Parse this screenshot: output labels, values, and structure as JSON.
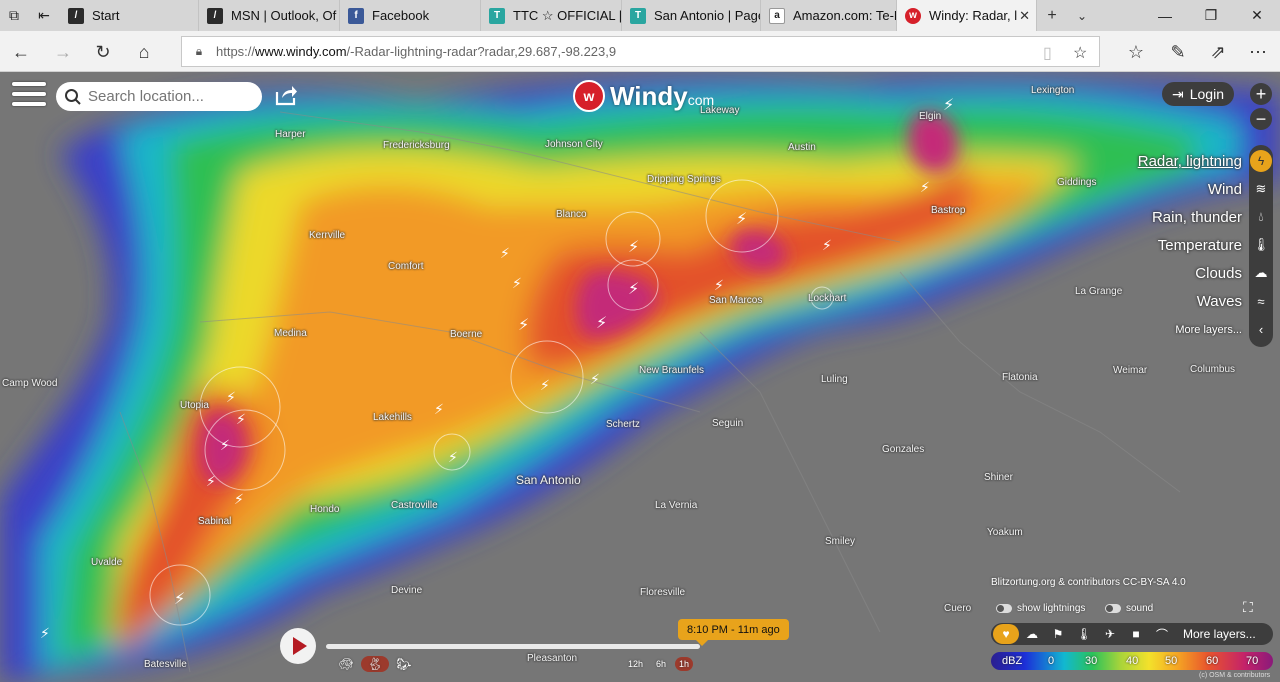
{
  "browser": {
    "tabs": [
      {
        "label": "Start",
        "favicon": "edge-page-icon",
        "color": "#2b2b2b"
      },
      {
        "label": "MSN | Outlook, Of",
        "favicon": "edge-page-icon",
        "color": "#2b2b2b"
      },
      {
        "label": "Facebook",
        "favicon": "facebook-icon",
        "color": "#3b5998"
      },
      {
        "label": "TTC ☆ OFFICIAL | F",
        "favicon": "ttc-icon",
        "color": "#2aa6a0"
      },
      {
        "label": "San Antonio | Page",
        "favicon": "ttc-icon",
        "color": "#2aa6a0"
      },
      {
        "label": "Amazon.com: Te-R",
        "favicon": "amazon-icon",
        "color": "#222222"
      },
      {
        "label": "Windy: Radar, l",
        "favicon": "windy-icon",
        "color": "#d6202a",
        "active": true
      }
    ],
    "url": {
      "prefix": "https://",
      "host": "www.windy.com",
      "path": "/-Radar-lightning-radar?radar,29.687,-98.223,9"
    }
  },
  "windy": {
    "search_placeholder": "Search location...",
    "logo_text": "Windy",
    "logo_suffix": "com",
    "login_label": "Login",
    "layers": [
      {
        "label": "Radar, lightning",
        "icon": "lightning-icon",
        "active": true
      },
      {
        "label": "Wind",
        "icon": "wind-icon"
      },
      {
        "label": "Rain, thunder",
        "icon": "raindrop-icon"
      },
      {
        "label": "Temperature",
        "icon": "thermometer-icon"
      },
      {
        "label": "Clouds",
        "icon": "cloud-icon"
      },
      {
        "label": "Waves",
        "icon": "waves-icon"
      },
      {
        "label": "More layers...",
        "icon": "chevron-left-icon"
      }
    ],
    "attribution": "Blitzortung.org & contributors CC-BY-SA 4.0",
    "toggles": {
      "lightnings": "show lightnings",
      "sound": "sound"
    },
    "bottom_bar_more": "More layers...",
    "legend": {
      "unit": "dBZ",
      "ticks": [
        "0",
        "30",
        "40",
        "50",
        "60",
        "70"
      ]
    },
    "osm_credit": "(c) OSM & contributors",
    "timeline": {
      "label": "8:10 PM - 11m ago",
      "ranges": [
        "12h",
        "6h",
        "1h"
      ],
      "selected_range": "1h",
      "progress": 1.0
    }
  },
  "places": [
    {
      "name": "Harper"
    },
    {
      "name": "Fredericksburg"
    },
    {
      "name": "Johnson City"
    },
    {
      "name": "Lakeway"
    },
    {
      "name": "Austin"
    },
    {
      "name": "Elgin"
    },
    {
      "name": "Lexington"
    },
    {
      "name": "Dripping Springs"
    },
    {
      "name": "Giddings"
    },
    {
      "name": "Bastrop"
    },
    {
      "name": "Kerrville"
    },
    {
      "name": "Blanco"
    },
    {
      "name": "Comfort"
    },
    {
      "name": "San Marcos"
    },
    {
      "name": "Lockhart"
    },
    {
      "name": "La Grange"
    },
    {
      "name": "Medina"
    },
    {
      "name": "Boerne"
    },
    {
      "name": "New Braunfels"
    },
    {
      "name": "Luling"
    },
    {
      "name": "Flatonia"
    },
    {
      "name": "Weimar"
    },
    {
      "name": "Columbus"
    },
    {
      "name": "Camp Wood"
    },
    {
      "name": "Utopia"
    },
    {
      "name": "Lakehills"
    },
    {
      "name": "Schertz"
    },
    {
      "name": "Seguin"
    },
    {
      "name": "Gonzales"
    },
    {
      "name": "San Antonio"
    },
    {
      "name": "Shiner"
    },
    {
      "name": "Hondo"
    },
    {
      "name": "Castroville"
    },
    {
      "name": "La Vernia"
    },
    {
      "name": "Sabinal"
    },
    {
      "name": "Yoakum"
    },
    {
      "name": "Smiley"
    },
    {
      "name": "Uvalde"
    },
    {
      "name": "Devine"
    },
    {
      "name": "Floresville"
    },
    {
      "name": "Cuero"
    },
    {
      "name": "Pleasanton"
    },
    {
      "name": "Batesville"
    }
  ],
  "colors": {
    "accent": "#e8a31b",
    "brand": "#d6202a",
    "panel": "#3d3d3d"
  }
}
